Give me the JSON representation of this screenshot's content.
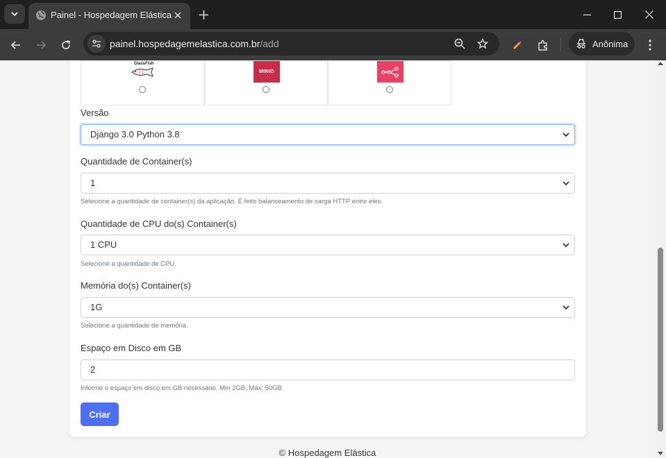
{
  "browser": {
    "tab_title": "Painel - Hospedagem Elástica",
    "url_host": "painel.hospedagemelastica.com.br",
    "url_path": "/add",
    "profile_label": "Anônima"
  },
  "images": [
    {
      "label": "GlassFish",
      "icon": "glassfish-logo"
    },
    {
      "label": "MINIO",
      "icon": "minio-logo"
    },
    {
      "label": "",
      "icon": "nodes-logo"
    }
  ],
  "form": {
    "version_label": "Versão",
    "version_value": "Django 3.0 Python 3.8",
    "containers_label": "Quantidade de Container(s)",
    "containers_value": "1",
    "containers_help": "Selecione a quantidade de container(s) da aplicação. É feito balanceamento de carga HTTP entre eles.",
    "cpu_label": "Quantidade de CPU do(s) Container(s)",
    "cpu_value": "1 CPU",
    "cpu_help": "Selecione a quantidade de CPU.",
    "memory_label": "Memória do(s) Container(s)",
    "memory_value": "1G",
    "memory_help": "Selecione a quantidade de memória.",
    "disk_label": "Espaço em Disco em GB",
    "disk_value": "2",
    "disk_help": "Informe o espaço em disco em GB necessário. Min 2GB, Máx: 50GB",
    "submit_label": "Criar"
  },
  "footer": {
    "text": "© Hospedagem Elástica"
  },
  "colors": {
    "primary": "#4f6ff1",
    "minio": "#c72c48",
    "nodes": "#e8416a"
  }
}
